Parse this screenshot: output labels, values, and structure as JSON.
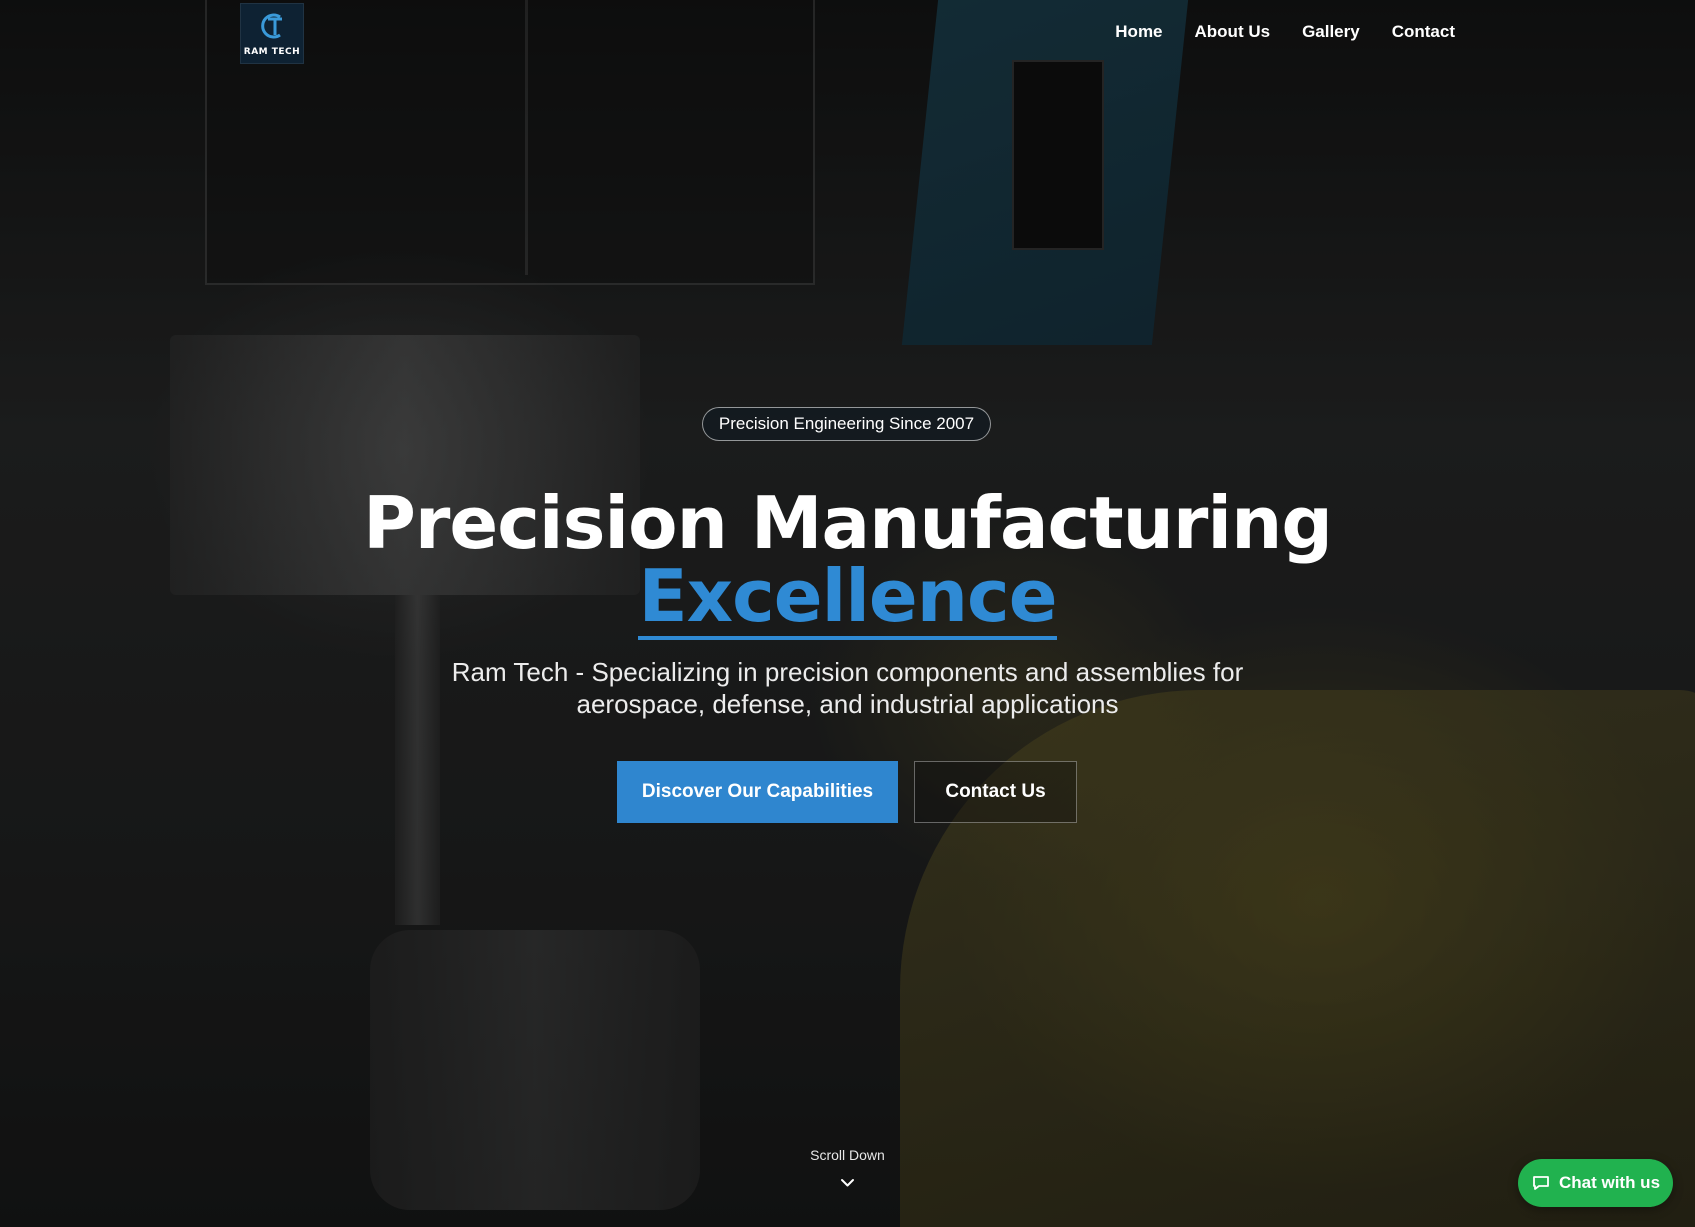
{
  "nav": {
    "logo_text": "RAM TECH",
    "items": [
      {
        "label": "Home"
      },
      {
        "label": "About Us"
      },
      {
        "label": "Gallery"
      },
      {
        "label": "Contact"
      }
    ]
  },
  "hero": {
    "badge": "Precision Engineering Since 2007",
    "title_line1": "Precision Manufacturing",
    "title_line2": "Excellence",
    "subtitle": "Ram Tech - Specializing in precision components and assemblies for aerospace, defense, and industrial applications",
    "primary_button": "Discover Our Capabilities",
    "secondary_button": "Contact Us",
    "scroll_label": "Scroll Down"
  },
  "chat": {
    "label": "Chat with us"
  },
  "colors": {
    "accent": "#2f86cf",
    "chat": "#21b24f",
    "logo_bg": "#0e2233"
  }
}
